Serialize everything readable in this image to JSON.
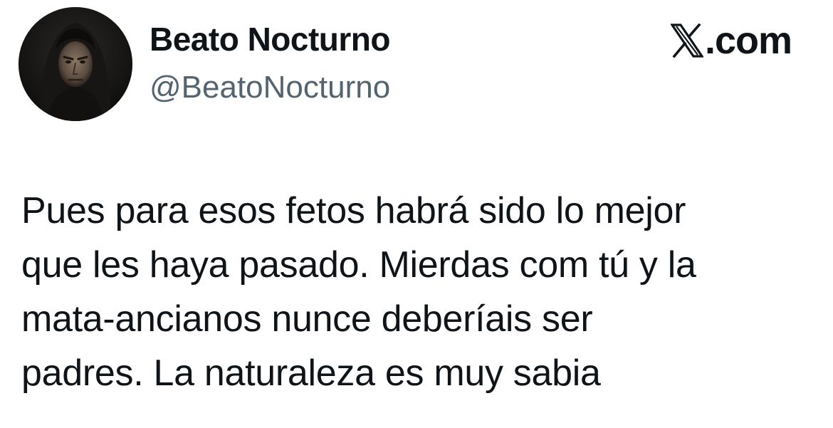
{
  "author": {
    "display_name": "Beato Nocturno",
    "handle": "@BeatoNocturno",
    "avatar_icon": "hooded-figure-avatar"
  },
  "brand": {
    "icon": "x-logo-icon",
    "domain": ".com"
  },
  "tweet": {
    "text": "Pues para esos fetos habrá sido lo mejor\nque les haya pasado. Mierdas com tú y la\nmata-ancianos nunce deberíais ser\npadres. La naturaleza es muy sabia"
  },
  "colors": {
    "text_primary": "#0f1419",
    "text_secondary": "#536471",
    "background": "#ffffff"
  }
}
